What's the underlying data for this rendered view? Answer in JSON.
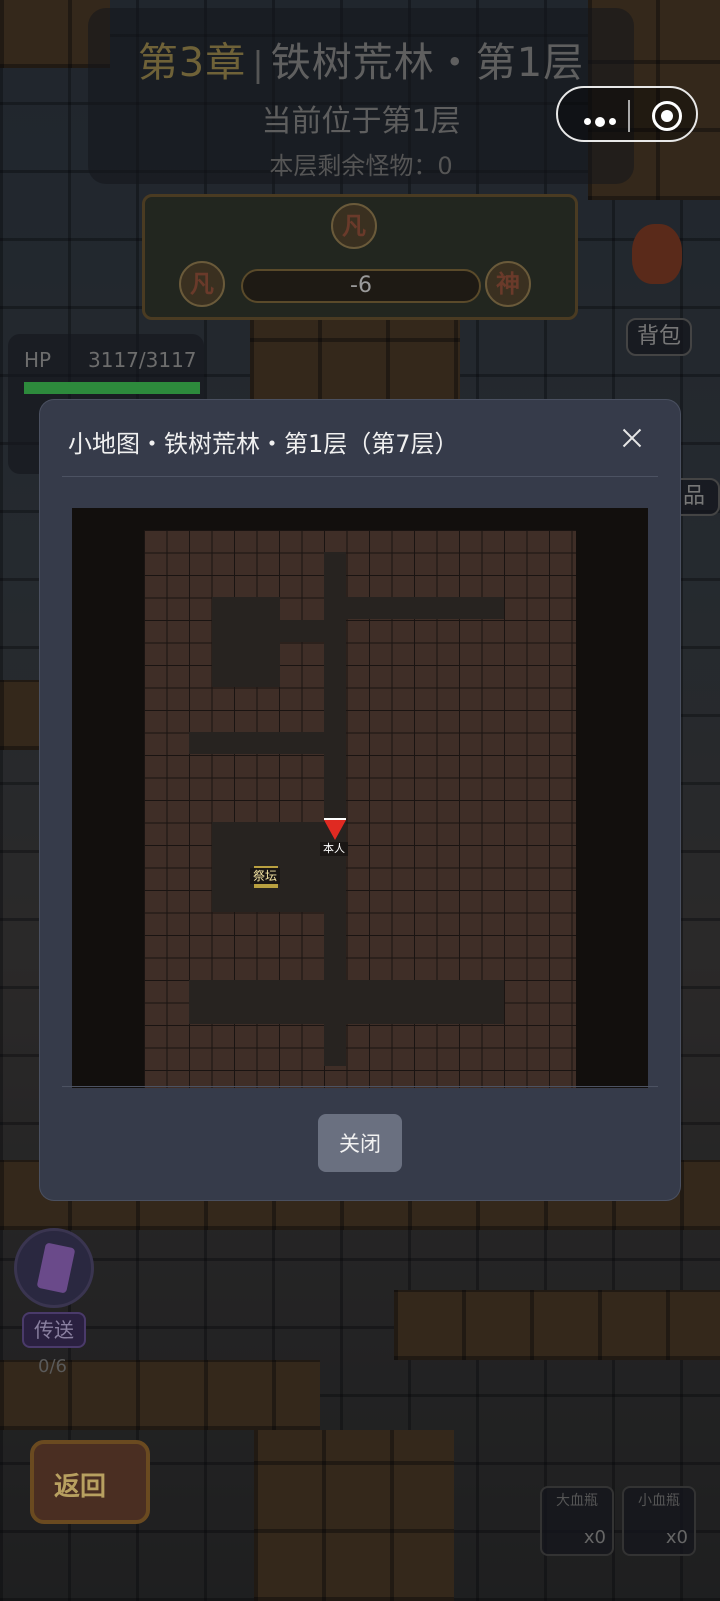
{
  "header": {
    "chapter": "第3章",
    "separator": "|",
    "map_name": "铁树荒林・第1层",
    "current_floor": "当前位于第1层",
    "monsters_remaining": "本层剩余怪物：0"
  },
  "realm": {
    "top_glyph": "凡",
    "left_glyph": "凡",
    "right_glyph": "神",
    "value": "-6"
  },
  "stats": {
    "hp_label": "HP",
    "hp_value": "3117/3117",
    "hp_fraction": 1.0,
    "colors": {
      "hp_bar": "#2d8a3c"
    }
  },
  "side": {
    "bag_label": "背包",
    "partial_label_1": "品"
  },
  "teleport": {
    "label": "传送",
    "count": "0/6"
  },
  "back_button": {
    "label": "返回"
  },
  "potions": [
    {
      "name": "大血瓶",
      "count": "x0"
    },
    {
      "name": "小血瓶",
      "count": "x0"
    }
  ],
  "modal": {
    "title": "小地图・铁树荒林・第1层（第7层）",
    "close_icon": "close-icon",
    "close_button": "关闭",
    "markers": {
      "player_label": "本人",
      "altar_label": "祭坛"
    },
    "colors": {
      "panel_bg": "#363b4a",
      "floor_tile": "#3f2e27",
      "wall_tile": "#272320",
      "player": "#e02a22",
      "altar": "#b9a040"
    }
  },
  "capsule": {
    "menu_icon": "more-dots-icon",
    "close_icon": "target-circle-icon"
  }
}
